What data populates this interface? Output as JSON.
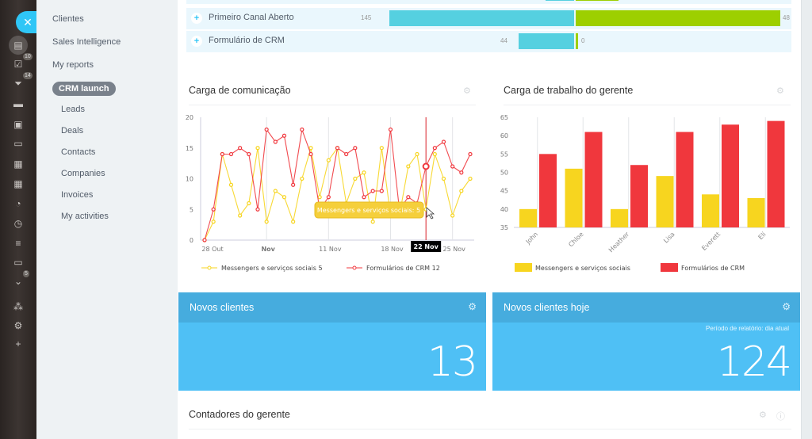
{
  "rail": {
    "close_icon": "✕",
    "icons": [
      {
        "name": "feed-icon",
        "glyph": "▤",
        "active": true
      },
      {
        "name": "tasks-icon",
        "glyph": "☑",
        "badge": "10"
      },
      {
        "name": "crm-funnel-icon",
        "glyph": "⏷",
        "badge": "14"
      },
      {
        "name": "drive-icon",
        "glyph": "▬"
      },
      {
        "name": "contacts-icon",
        "glyph": "▣"
      },
      {
        "name": "inbox-icon",
        "glyph": "▭"
      },
      {
        "name": "apps-icon",
        "glyph": "▦"
      },
      {
        "name": "calendar-icon",
        "glyph": "▦"
      },
      {
        "name": "timeman-icon",
        "glyph": "◔"
      },
      {
        "name": "clock-icon",
        "glyph": "◷"
      },
      {
        "name": "sliders-icon",
        "glyph": "≡"
      },
      {
        "name": "window-icon",
        "glyph": "▭"
      },
      {
        "name": "more-icon",
        "glyph": "⌄",
        "badge": "5"
      },
      {
        "name": "structure-icon",
        "glyph": "⁂"
      },
      {
        "name": "settings-icon",
        "glyph": "⚙"
      },
      {
        "name": "add-icon",
        "glyph": "+"
      }
    ]
  },
  "menu": {
    "items": [
      "Clientes",
      "Sales Intelligence",
      "My reports"
    ],
    "active": "CRM launch",
    "sub_items": [
      "Leads",
      "Deals",
      "Contacts",
      "Companies",
      "Invoices",
      "My activities"
    ]
  },
  "source_table": {
    "rows": [
      {
        "label": "Primeiro Canal Aberto",
        "left_value": "145",
        "right_value": "48",
        "left_frac": 1.0,
        "right_frac": 1.0
      },
      {
        "label": "Formulário de CRM",
        "left_value": "44",
        "right_value": "0",
        "left_frac": 0.3,
        "right_frac": 0.0
      }
    ],
    "colors": {
      "left": "#55d0e0",
      "right": "#9dcf00"
    }
  },
  "widgets": {
    "comm_load_title": "Carga de comunicação",
    "workload_title": "Carga de trabalho do gerente",
    "new_clients_title": "Novos clientes",
    "new_clients_value": "13",
    "new_clients_today_title": "Novos clientes hoje",
    "new_clients_today_period": "Período de relatório: dia atual",
    "new_clients_today_value": "124",
    "manager_counters_title": "Contadores do gerente"
  },
  "chart_data": [
    {
      "type": "line",
      "title": "Carga de comunicação",
      "xlabel": "",
      "ylabel": "",
      "ylim": [
        0,
        20
      ],
      "yticks": [
        0,
        5,
        10,
        15,
        20
      ],
      "x_tick_labels": [
        {
          "index": 0,
          "label": "28 Out",
          "bold": false
        },
        {
          "index": 7,
          "label": "Nov",
          "bold": true
        },
        {
          "index": 14,
          "label": "11 Nov",
          "bold": false
        },
        {
          "index": 21,
          "label": "18 Nov",
          "bold": false
        },
        {
          "index": 28,
          "label": "25 Nov",
          "bold": false
        }
      ],
      "grid": "vertical",
      "series": [
        {
          "name": "Messengers e serviços sociais",
          "legend_value": "5",
          "color": "#f7d51f",
          "values": [
            0,
            3,
            14,
            9,
            4,
            6,
            15,
            3,
            8,
            7,
            3,
            10,
            15,
            7,
            13,
            15,
            6,
            10,
            11,
            3,
            15,
            4,
            4,
            12,
            14,
            5,
            14,
            10,
            4,
            8,
            10
          ]
        },
        {
          "name": "Formulários de CRM",
          "legend_value": "12",
          "color": "#f0373d",
          "values": [
            0,
            5,
            14,
            14,
            15,
            14,
            5,
            18,
            16,
            17,
            9,
            18,
            14,
            5,
            7,
            15,
            14,
            15,
            7,
            8,
            8,
            18,
            5,
            7,
            6,
            12,
            15,
            16,
            12,
            11,
            14
          ]
        }
      ],
      "crosshair": {
        "index": 25,
        "label": "22 Nov"
      },
      "tooltip": "Messengers e serviços sociais: 5",
      "legend": "bottom"
    },
    {
      "type": "bar",
      "title": "Carga de trabalho do gerente",
      "categories": [
        "John",
        "Chloe",
        "Heather",
        "Lisa",
        "Everett",
        "Eli"
      ],
      "ylim": [
        35,
        65
      ],
      "yticks": [
        35,
        40,
        45,
        50,
        55,
        60,
        65
      ],
      "series": [
        {
          "name": "Messengers e serviços sociais",
          "color": "#f7d51f",
          "values": [
            40,
            51,
            40,
            49,
            44,
            43
          ]
        },
        {
          "name": "Formulários de CRM",
          "color": "#f0373d",
          "values": [
            55,
            61,
            52,
            61,
            63,
            64
          ]
        }
      ],
      "legend": "bottom"
    }
  ]
}
